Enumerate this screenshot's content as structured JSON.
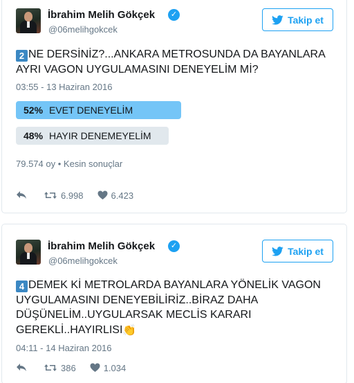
{
  "tweets": [
    {
      "author_name": "İbrahim Melih Gökçek",
      "handle": "@06melihgokcek",
      "follow_label": "Takip et",
      "number_badge": "2",
      "text": "NE DERSİNİZ?...ANKARA METROSUNDA DA BAYANLARA AYRI VAGON UYGULAMASINI DENEYELİM Mİ?",
      "timestamp": "03:55 - 13 Haziran 2016",
      "poll": {
        "options": [
          {
            "percent": "52%",
            "label": "EVET DENEYELİM",
            "value": 52,
            "winner": true
          },
          {
            "percent": "48%",
            "label": "HAYIR DENEMEYELİM",
            "value": 48,
            "winner": false
          }
        ],
        "votes": "79.574 oy",
        "status": "Kesin sonuçlar"
      },
      "retweets": "6.998",
      "likes": "6.423"
    },
    {
      "author_name": "İbrahim Melih Gökçek",
      "handle": "@06melihgokcek",
      "follow_label": "Takip et",
      "number_badge": "4",
      "text": "DEMEK Kİ METROLARDA BAYANLARA YÖNELİK VAGON UYGULAMASINI DENEYEBİLİRİZ..BİRAZ DAHA DÜŞÜNELİM..UYGULARSAK MECLİS KARARI GEREKLİ..HAYIRLISI",
      "timestamp": "04:11 - 14 Haziran 2016",
      "retweets": "386",
      "likes": "1.034"
    }
  ],
  "separator": "•",
  "colors": {
    "accent": "#1da1f2",
    "poll_winner": "#74c5f7",
    "poll_other": "#e1e8ed",
    "muted_text": "#657786",
    "keycap": "#3b88c3"
  },
  "icons": [
    "verified-badge-icon",
    "twitter-bird-icon",
    "reply-icon",
    "retweet-icon",
    "heart-icon",
    "keycap-number-icon",
    "clapping-hands-icon"
  ]
}
